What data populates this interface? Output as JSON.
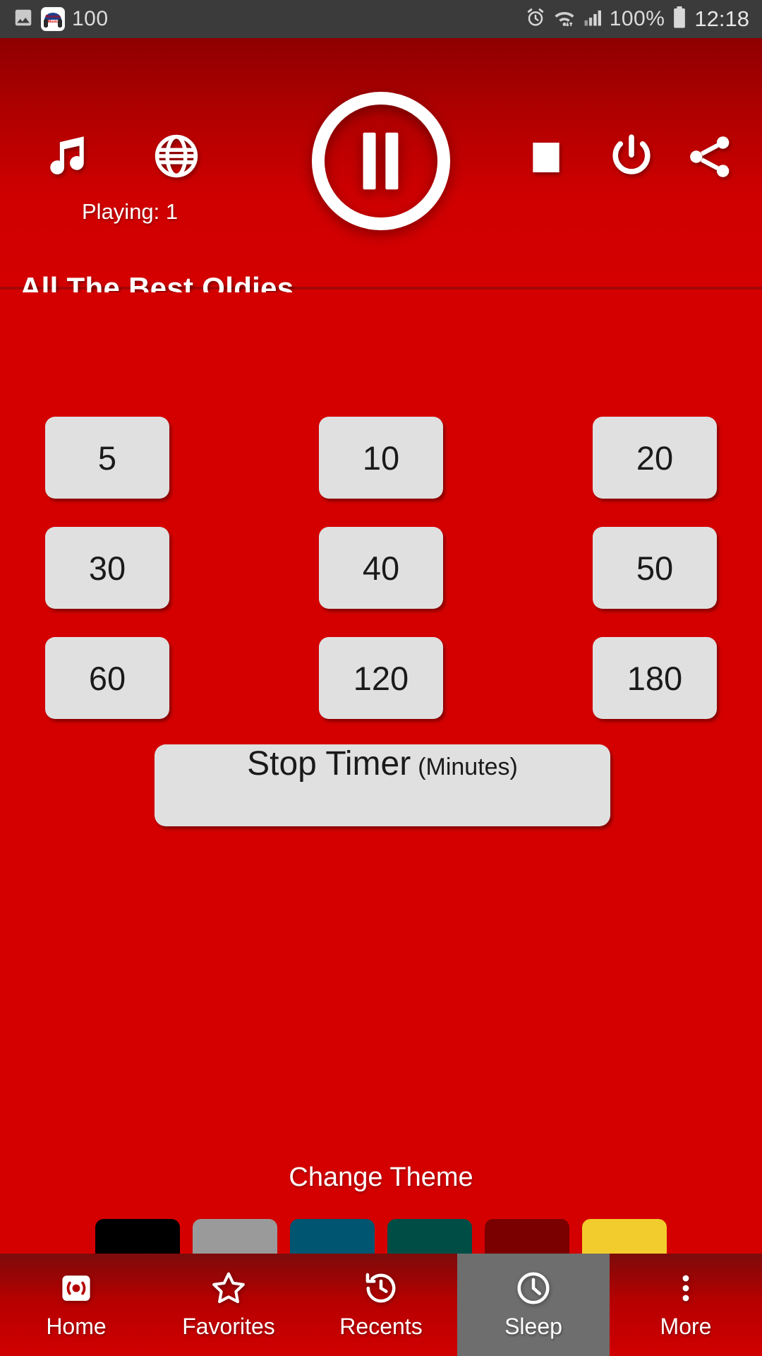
{
  "status_bar": {
    "notification_count": "100",
    "app_icon_name": "nonstop-music-app-icon",
    "battery_percent": "100%",
    "time": "12:18",
    "icons": [
      "image-icon",
      "alarm-icon",
      "wifi-icon",
      "signal-icon",
      "battery-icon"
    ]
  },
  "header": {
    "playing_label": "Playing: 1",
    "station_title": "All The Best Oldies",
    "toolbar": {
      "music_icon": "music-note-icon",
      "globe_icon": "globe-icon",
      "play_pause_icon": "pause-icon",
      "stop_icon": "stop-icon",
      "power_icon": "power-icon",
      "share_icon": "share-icon"
    },
    "gradient_top": "#8e0000",
    "gradient_bottom": "#d40000"
  },
  "sleep_timer": {
    "rows": [
      [
        "5",
        "10",
        "20"
      ],
      [
        "30",
        "40",
        "50"
      ],
      [
        "60",
        "120",
        "180"
      ]
    ],
    "stop_button": {
      "main_label": "Stop Timer",
      "sub_label": "(Minutes)"
    },
    "button_color": "#e0e0e0"
  },
  "theme": {
    "label": "Change Theme",
    "swatches": [
      {
        "name": "black",
        "color": "#000000"
      },
      {
        "name": "gray",
        "color": "#9a9a9a"
      },
      {
        "name": "teal-blue",
        "color": "#005670"
      },
      {
        "name": "green",
        "color": "#004d45"
      },
      {
        "name": "dark-red",
        "color": "#7a0000"
      },
      {
        "name": "yellow",
        "color": "#f2cc2c"
      }
    ]
  },
  "bottom_nav": {
    "selected": "Sleep",
    "items": [
      {
        "label": "Home",
        "icon": "radio-icon"
      },
      {
        "label": "Favorites",
        "icon": "star-icon"
      },
      {
        "label": "Recents",
        "icon": "history-icon"
      },
      {
        "label": "Sleep",
        "icon": "clock-icon"
      },
      {
        "label": "More",
        "icon": "more-vertical-icon"
      }
    ]
  },
  "colors": {
    "background_red": "#d40000",
    "selected_nav": "#6e6e6e"
  }
}
